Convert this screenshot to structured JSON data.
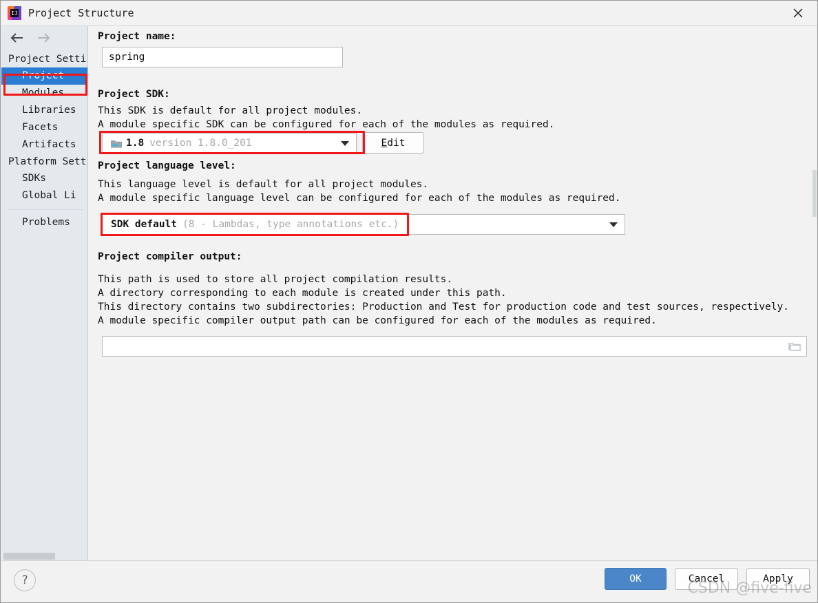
{
  "window": {
    "title": "Project Structure",
    "app_icon": "intellij-idea-logo",
    "close_icon": "close-icon"
  },
  "nav": {
    "back_icon": "arrow-left-icon",
    "forward_icon": "arrow-right-icon"
  },
  "sidebar": {
    "groups": [
      {
        "title": "Project Setti",
        "items": [
          {
            "label": "Project",
            "selected": true
          },
          {
            "label": "Modules",
            "selected": false
          },
          {
            "label": "Libraries",
            "selected": false
          },
          {
            "label": "Facets",
            "selected": false
          },
          {
            "label": "Artifacts",
            "selected": false
          }
        ]
      },
      {
        "title": "Platform Sett",
        "items": [
          {
            "label": "SDKs",
            "selected": false
          },
          {
            "label": "Global Li",
            "selected": false
          }
        ]
      }
    ],
    "problems_label": "Problems"
  },
  "main": {
    "project_name": {
      "label": "Project name:",
      "value": "spring",
      "placeholder": ""
    },
    "project_sdk": {
      "label": "Project SDK:",
      "description": [
        "This SDK is default for all project modules.",
        "A module specific SDK can be configured for each of the modules as required."
      ],
      "selected_name": "1.8",
      "selected_detail": "version 1.8.0_201",
      "folder_icon": "folder-icon",
      "caret_icon": "chevron-down-icon",
      "edit_label": "Edit",
      "edit_mnemonic": "E",
      "edit_rest": "dit"
    },
    "language_level": {
      "label": "Project language level:",
      "description": [
        "This language level is default for all project modules.",
        "A module specific language level can be configured for each of the modules as required."
      ],
      "selected_name": "SDK default",
      "selected_detail": "(8 - Lambdas, type annotations etc.)",
      "caret_icon": "chevron-down-icon"
    },
    "compiler_output": {
      "label": "Project compiler output:",
      "description": [
        "This path is used to store all project compilation results.",
        "A directory corresponding to each module is created under this path.",
        "This directory contains two subdirectories: Production and Test for production code and test sources, respectively.",
        "A module specific compiler output path can be configured for each of the modules as required."
      ],
      "value": "",
      "browse_icon": "folder-browse-icon"
    }
  },
  "footer": {
    "help_label": "?",
    "ok_label": "OK",
    "cancel_label": "Cancel",
    "apply_label": "Apply"
  },
  "watermark": {
    "text": "CSDN @five-five"
  },
  "annotations": {
    "accent_color": "#f01818",
    "selection_color": "#2b7cd3"
  }
}
